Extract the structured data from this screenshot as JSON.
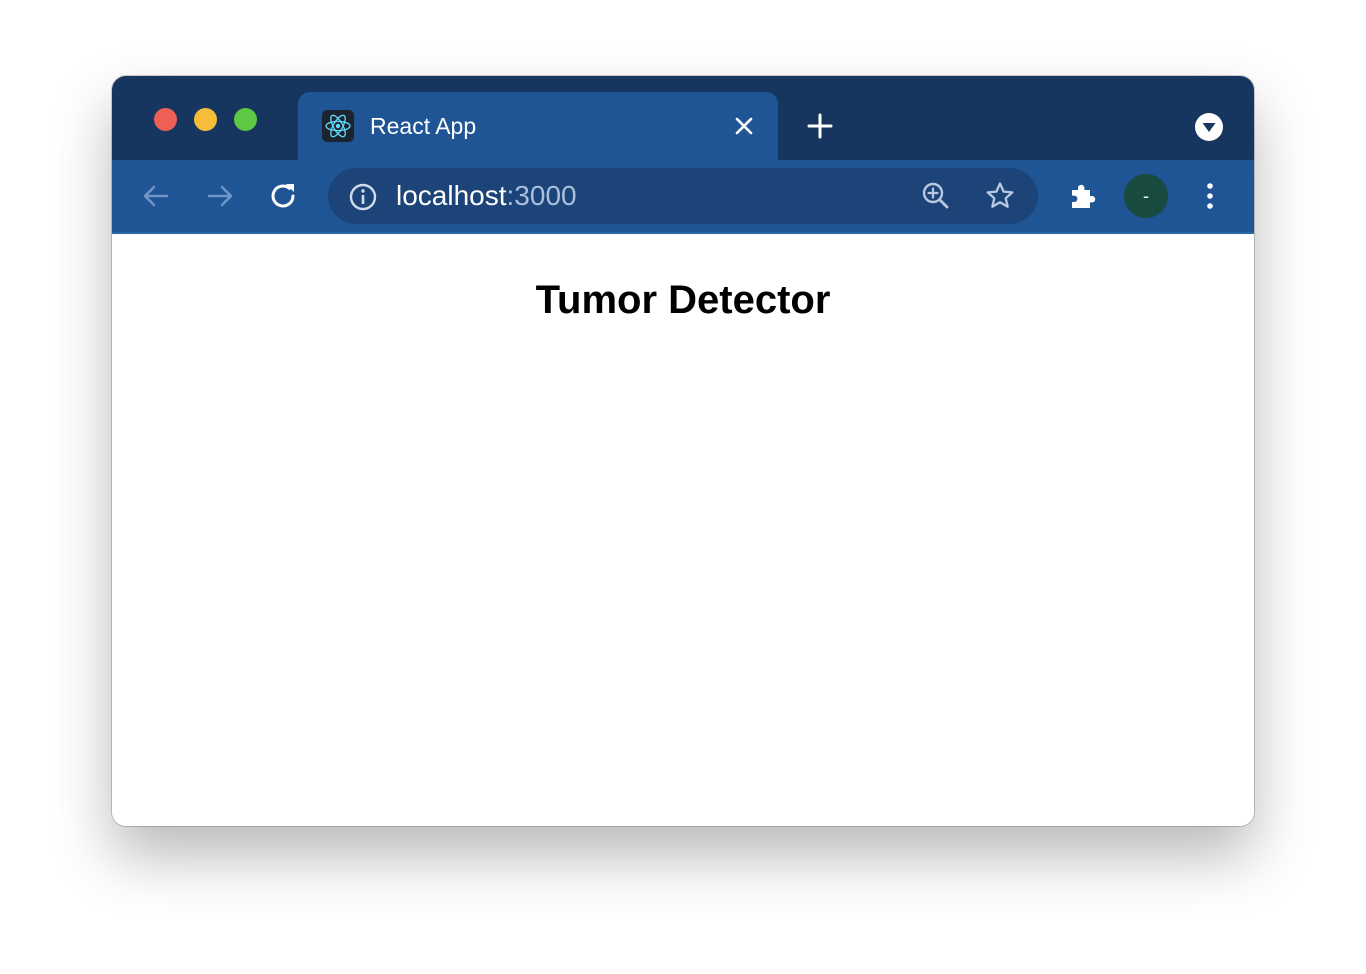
{
  "browser": {
    "tab": {
      "title": "React App",
      "favicon_icon": "react-logo-icon"
    },
    "omnibox": {
      "host": "localhost",
      "port": ":3000"
    },
    "profile": {
      "initial": "-",
      "color": "#184a3f"
    },
    "colors": {
      "tabstrip": "#17365f",
      "toolbar": "#1f5594",
      "omnibox": "#1c4478"
    }
  },
  "page": {
    "title": "Tumor Detector"
  }
}
